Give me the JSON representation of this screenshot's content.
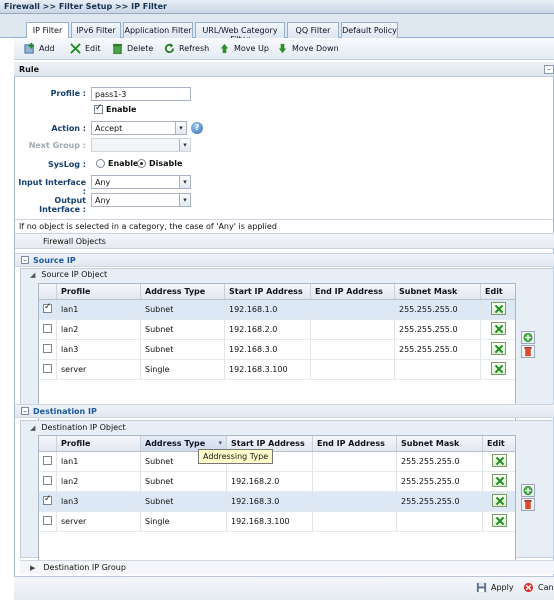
{
  "breadcrumb": "Firewall >> Filter Setup >> IP Filter",
  "tabs": [
    "IP Filter",
    "IPv6 Filter",
    "Application Filter",
    "URL/Web Category Filter",
    "QQ Filter",
    "Default Policy"
  ],
  "toolbar": {
    "add": "Add",
    "edit": "Edit",
    "delete": "Delete",
    "refresh": "Refresh",
    "move_up": "Move Up",
    "move_down": "Move Down"
  },
  "rule": {
    "heading": "Rule",
    "collapse": "–",
    "profile_label": "Profile :",
    "profile_value": "pass1-3",
    "enable_label": "Enable",
    "action_label": "Action :",
    "action_value": "Accept",
    "next_group_label": "Next Group :",
    "next_group_value": "",
    "syslog_label": "SysLog :",
    "syslog_enable": "Enable",
    "syslog_disable": "Disable",
    "input_if_label": "Input Interface :",
    "input_if_value": "Any",
    "output_if_label": "Output Interface :",
    "output_if_value": "Any"
  },
  "note": "If no object is selected in a category, the case of 'Any' is applied",
  "firewall_objects_label": "Firewall Objects",
  "source": {
    "title": "Source IP",
    "object_title": "Source IP Object",
    "columns": [
      "Profile",
      "Address Type",
      "Start IP Address",
      "End IP Address",
      "Subnet Mask",
      "Edit"
    ],
    "rows": [
      {
        "checked": true,
        "profile": "lan1",
        "type": "Subnet",
        "start": "192.168.1.0",
        "end": "",
        "mask": "255.255.255.0"
      },
      {
        "checked": false,
        "profile": "lan2",
        "type": "Subnet",
        "start": "192.168.2.0",
        "end": "",
        "mask": "255.255.255.0"
      },
      {
        "checked": false,
        "profile": "lan3",
        "type": "Subnet",
        "start": "192.168.3.0",
        "end": "",
        "mask": "255.255.255.0"
      },
      {
        "checked": false,
        "profile": "server",
        "type": "Single",
        "start": "192.168.3.100",
        "end": "",
        "mask": ""
      }
    ]
  },
  "destination": {
    "title": "Destination IP",
    "object_title": "Destination IP Object",
    "columns": [
      "Profile",
      "Address Type",
      "Start IP Address",
      "End IP Address",
      "Subnet Mask",
      "Edit"
    ],
    "rows": [
      {
        "checked": false,
        "profile": "lan1",
        "type": "Subnet",
        "start": "",
        "end": "",
        "mask": "255.255.255.0"
      },
      {
        "checked": false,
        "profile": "lan2",
        "type": "Subnet",
        "start": "192.168.2.0",
        "end": "",
        "mask": "255.255.255.0"
      },
      {
        "checked": true,
        "profile": "lan3",
        "type": "Subnet",
        "start": "192.168.3.0",
        "end": "",
        "mask": "255.255.255.0"
      },
      {
        "checked": false,
        "profile": "server",
        "type": "Single",
        "start": "192.168.3.100",
        "end": "",
        "mask": ""
      }
    ],
    "tooltip": "Addressing Type",
    "group_title": "Destination IP Group"
  },
  "footer": {
    "apply": "Apply",
    "cancel": "Canc"
  }
}
